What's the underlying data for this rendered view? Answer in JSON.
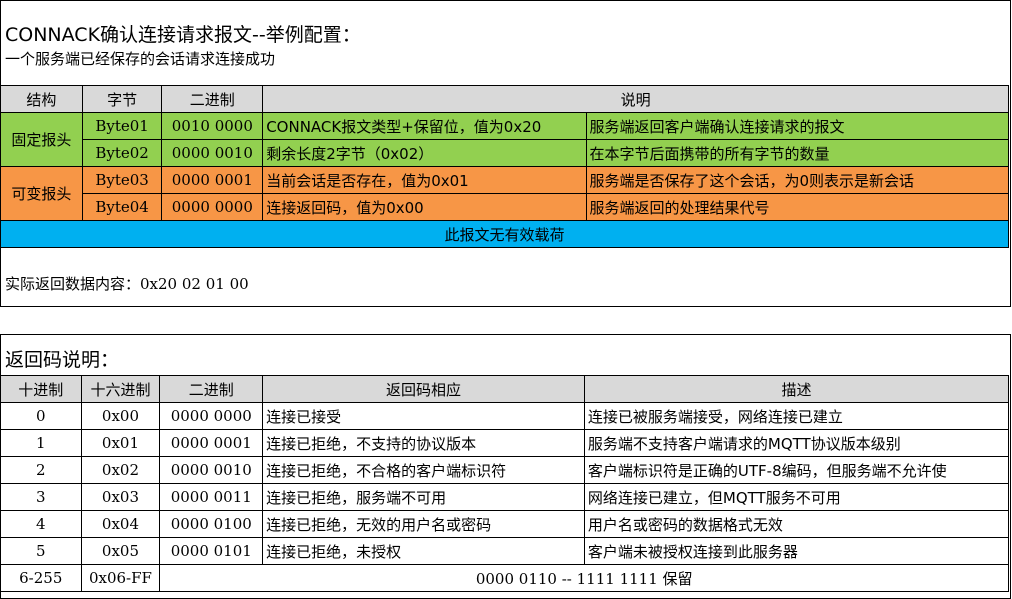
{
  "connack": {
    "title": "CONNACK确认连接请求报文--举例配置：",
    "subtitle": "一个服务端已经保存的会话请求连接成功",
    "headers": {
      "struct": "结构",
      "byte": "字节",
      "binary": "二进制",
      "desc": "说明"
    },
    "fixed_header": "固定报头",
    "variable_header": "可变报头",
    "rows": [
      {
        "byte": "Byte01",
        "binary": "0010 0000",
        "field": "CONNACK报文类型+保留位，值为0x20",
        "desc": "服务端返回客户端确认连接请求的报文"
      },
      {
        "byte": "Byte02",
        "binary": "0000 0010",
        "field": "剩余长度2字节（0x02）",
        "desc": "在本字节后面携带的所有字节的数量"
      },
      {
        "byte": "Byte03",
        "binary": "0000 0001",
        "field": "当前会话是否存在，值为0x01",
        "desc": "服务端是否保存了这个会话，为0则表示是新会话"
      },
      {
        "byte": "Byte04",
        "binary": "0000 0000",
        "field": "连接返回码，值为0x00",
        "desc": "服务端返回的处理结果代号"
      }
    ],
    "payload_note": "此报文无有效载荷",
    "actual_label": "实际返回数据内容：",
    "actual_value": "0x20 02 01 00"
  },
  "return_codes": {
    "title": "返回码说明：",
    "headers": {
      "dec": "十进制",
      "hex": "十六进制",
      "binary": "二进制",
      "meaning": "返回码相应",
      "desc": "描述"
    },
    "rows": [
      {
        "dec": "0",
        "hex": "0x00",
        "binary": "0000 0000",
        "meaning": "连接已接受",
        "desc": "连接已被服务端接受，网络连接已建立"
      },
      {
        "dec": "1",
        "hex": "0x01",
        "binary": "0000 0001",
        "meaning": "连接已拒绝，不支持的协议版本",
        "desc": "服务端不支持客户端请求的MQTT协议版本级别"
      },
      {
        "dec": "2",
        "hex": "0x02",
        "binary": "0000 0010",
        "meaning": "连接已拒绝，不合格的客户端标识符",
        "desc": "客户端标识符是正确的UTF-8编码，但服务端不允许使"
      },
      {
        "dec": "3",
        "hex": "0x03",
        "binary": "0000 0011",
        "meaning": "连接已拒绝，服务端不可用",
        "desc": "网络连接已建立，但MQTT服务不可用"
      },
      {
        "dec": "4",
        "hex": "0x04",
        "binary": "0000 0100",
        "meaning": "连接已拒绝，无效的用户名或密码",
        "desc": "用户名或密码的数据格式无效"
      },
      {
        "dec": "5",
        "hex": "0x05",
        "binary": "0000 0101",
        "meaning": "连接已拒绝，未授权",
        "desc": "客户端未被授权连接到此服务器"
      }
    ],
    "reserved": {
      "dec": "6-255",
      "hex": "0x06-FF",
      "text": "0000 0110 -- 1111 1111 保留"
    }
  },
  "colors": {
    "header_gray": "#d9d9d9",
    "fixed_green": "#92d050",
    "variable_orange": "#f79646",
    "payload_blue": "#00b0f0"
  }
}
